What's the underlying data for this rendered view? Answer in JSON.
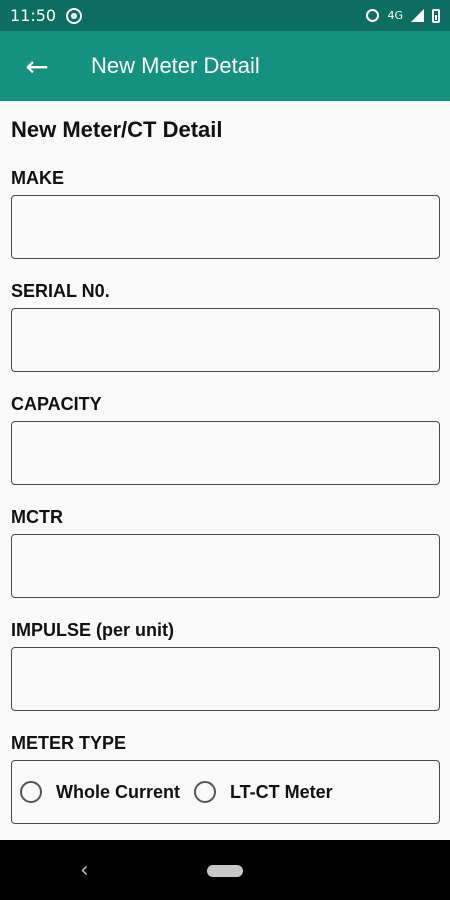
{
  "status": {
    "time": "11:50",
    "network": "4G"
  },
  "appbar": {
    "title": "New Meter Detail"
  },
  "form": {
    "title": "New Meter/CT Detail",
    "fields": [
      {
        "label": "MAKE",
        "value": ""
      },
      {
        "label": "SERIAL N0.",
        "value": ""
      },
      {
        "label": "CAPACITY",
        "value": ""
      },
      {
        "label": "MCTR",
        "value": ""
      },
      {
        "label": "IMPULSE (per unit)",
        "value": ""
      }
    ],
    "meter_type": {
      "label": "METER TYPE",
      "options": [
        "Whole Current",
        "LT-CT Meter"
      ]
    }
  },
  "icons": [
    "data-saver-icon",
    "alarm-icon",
    "signal-icon",
    "battery-icon",
    "back-arrow-icon",
    "nav-back-icon",
    "home-pill-icon"
  ],
  "colors": {
    "statusbar": "#0b6e60",
    "appbar": "#14917f"
  }
}
